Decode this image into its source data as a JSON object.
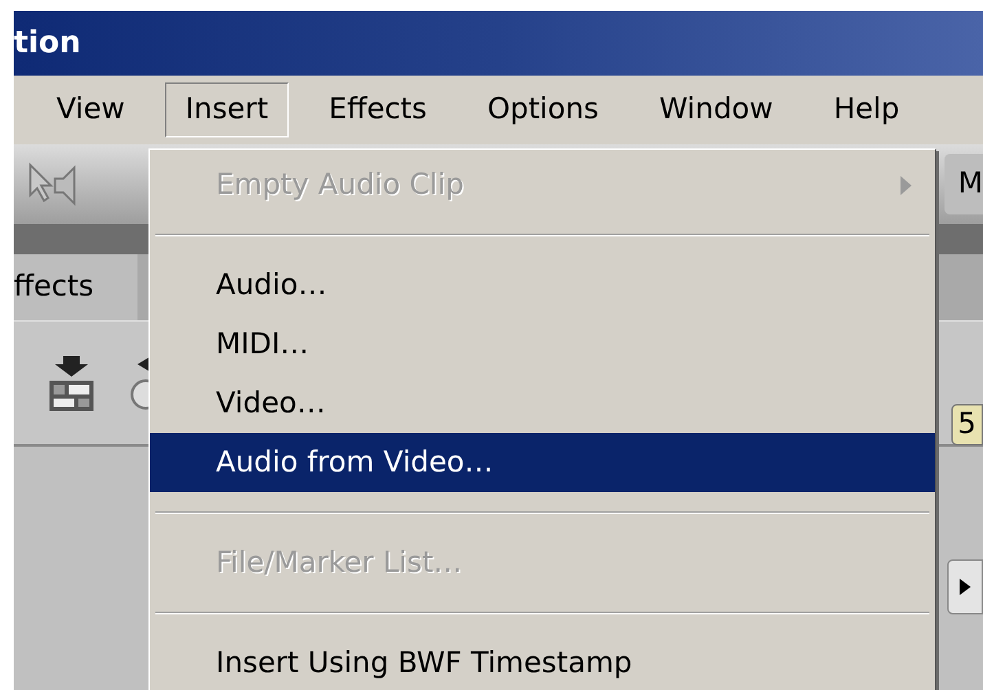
{
  "window": {
    "title": "tion"
  },
  "menu_bar": [
    {
      "label": "View",
      "selected": false
    },
    {
      "label": "Insert",
      "selected": true
    },
    {
      "label": "Effects",
      "selected": false
    },
    {
      "label": "Options",
      "selected": false
    },
    {
      "label": "Window",
      "selected": false
    },
    {
      "label": "Help",
      "selected": false
    }
  ],
  "toolbar": {
    "label": "M"
  },
  "panel": {
    "tab": "ffects",
    "badge": "5"
  },
  "menu": [
    {
      "kind": "item",
      "label": "Empty Audio Clip",
      "disabled": true,
      "submenu": true,
      "selected": false
    },
    {
      "kind": "separator"
    },
    {
      "kind": "item",
      "label": "Audio…",
      "disabled": false,
      "submenu": false,
      "selected": false
    },
    {
      "kind": "item",
      "label": "MIDI…",
      "disabled": false,
      "submenu": false,
      "selected": false
    },
    {
      "kind": "item",
      "label": "Video…",
      "disabled": false,
      "submenu": false,
      "selected": false
    },
    {
      "kind": "item",
      "label": "Audio from Video…",
      "disabled": false,
      "submenu": false,
      "selected": true
    },
    {
      "kind": "separator"
    },
    {
      "kind": "item",
      "label": "File/Marker List…",
      "disabled": true,
      "submenu": false,
      "selected": false
    },
    {
      "kind": "separator"
    },
    {
      "kind": "item",
      "label": "Insert Using BWF Timestamp",
      "disabled": false,
      "submenu": false,
      "selected": false
    }
  ]
}
